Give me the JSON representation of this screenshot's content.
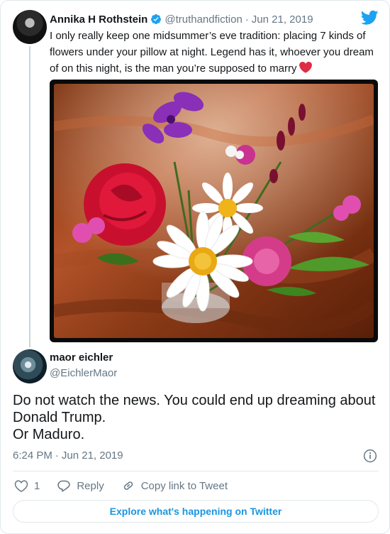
{
  "colors": {
    "accent": "#1da1f2",
    "link": "#1b95e0",
    "muted": "#657786",
    "heart": "#e0245e",
    "text": "#14171a"
  },
  "quoted_tweet": {
    "author_name": "Annika H Rothstein",
    "handle": "@truthandfiction",
    "separator": "·",
    "date": "Jun 21, 2019",
    "text": "I only really keep one midsummer’s eve tradition: placing 7 kinds of flowers under your pillow at night. Legend has it, whoever you dream of on this night, is the man you’re supposed to marry",
    "emoji": "red-heart",
    "verified_icon": "verified-badge-icon",
    "media": "flower-bouquet-photo"
  },
  "reply_tweet": {
    "author_name": "maor eichler",
    "handle": "@EichlerMaor",
    "text_lines": [
      "Do not watch the news. You could end up dreaming about",
      "Donald Trump.",
      "Or Maduro."
    ],
    "time": "6:24 PM",
    "separator": "·",
    "date": "Jun 21, 2019"
  },
  "actions": {
    "like_count": "1",
    "reply_label": "Reply",
    "copy_link_label": "Copy link to Tweet"
  },
  "explore_label": "Explore what's happening on Twitter",
  "icons": [
    "twitter-bird-icon",
    "verified-badge-icon",
    "info-icon",
    "heart-icon",
    "reply-bubble-icon",
    "link-icon"
  ]
}
